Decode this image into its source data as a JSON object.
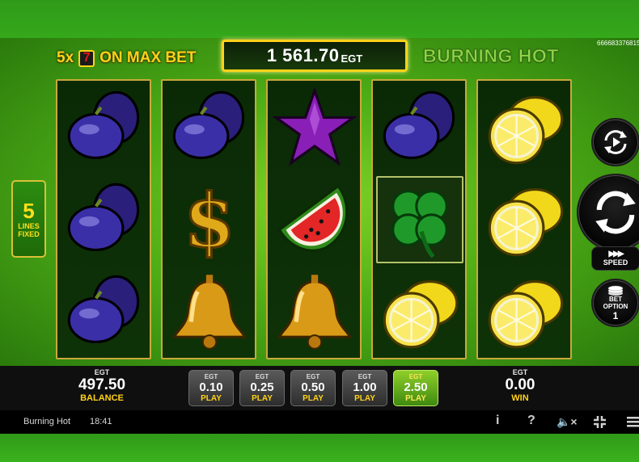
{
  "header": {
    "promo_multiplier": "5x",
    "promo_symbol": "7",
    "promo_text": "ON MAX BET",
    "jackpot_amount": "1 561.70",
    "jackpot_unit": "EGT",
    "game_logo": "BURNING HOT",
    "session_id": "666683376815"
  },
  "reels": [
    [
      "plum",
      "plum",
      "plum"
    ],
    [
      "plum",
      "dollar",
      "bell"
    ],
    [
      "star",
      "watermelon",
      "bell"
    ],
    [
      "plum",
      "clover",
      "lemon"
    ],
    [
      "lemon",
      "lemon",
      "lemon"
    ]
  ],
  "lines": {
    "count": "5",
    "label_1": "LINES",
    "label_2": "FIXED"
  },
  "controls": {
    "autoplay_icon": "autoplay-icon",
    "spin_icon": "spin-icon",
    "speed_glyph": "▶▶▶",
    "speed_label": "SPEED",
    "bet_option_label_1": "BET",
    "bet_option_label_2": "OPTION",
    "bet_option_value": "1"
  },
  "balance": {
    "currency": "EGT",
    "value": "497.50",
    "label": "BALANCE"
  },
  "win": {
    "currency": "EGT",
    "value": "0.00",
    "label": "WIN"
  },
  "bets": [
    {
      "currency": "EGT",
      "amount": "0.10",
      "action": "PLAY",
      "active": false
    },
    {
      "currency": "EGT",
      "amount": "0.25",
      "action": "PLAY",
      "active": false
    },
    {
      "currency": "EGT",
      "amount": "0.50",
      "action": "PLAY",
      "active": false
    },
    {
      "currency": "EGT",
      "amount": "1.00",
      "action": "PLAY",
      "active": false
    },
    {
      "currency": "EGT",
      "amount": "2.50",
      "action": "PLAY",
      "active": true
    }
  ],
  "statusbar": {
    "game_title": "Burning Hot",
    "time": "18:41",
    "info_icon": "i",
    "help_icon": "?",
    "sound_icon": "🔈×",
    "fullscreen_icon": "fullscreen-exit-icon",
    "menu_icon": "menu-icon"
  },
  "colors": {
    "gold": "#ffd21a",
    "reel_bg": "#0e3208",
    "active_bet": "#6fb81e",
    "panel": "#0f0f0f"
  }
}
